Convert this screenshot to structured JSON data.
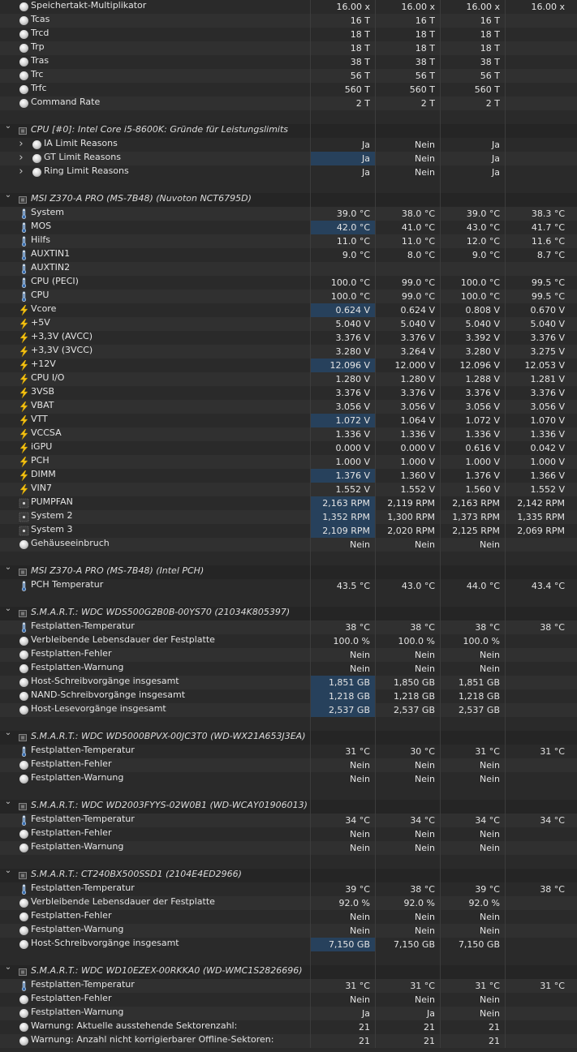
{
  "colors": {
    "background": "#2b2b2b",
    "highlight": "#27415c",
    "text": "#e4e4e4"
  },
  "rows": [
    {
      "t": "s",
      "icon": "circle",
      "label": "Speichertakt-Multiplikator",
      "v": [
        "16.00 x",
        "16.00 x",
        "16.00 x",
        "16.00 x"
      ]
    },
    {
      "t": "s",
      "icon": "circle",
      "label": "Tcas",
      "v": [
        "16 T",
        "16 T",
        "16 T",
        ""
      ]
    },
    {
      "t": "s",
      "icon": "circle",
      "label": "Trcd",
      "v": [
        "18 T",
        "18 T",
        "18 T",
        ""
      ]
    },
    {
      "t": "s",
      "icon": "circle",
      "label": "Trp",
      "v": [
        "18 T",
        "18 T",
        "18 T",
        ""
      ]
    },
    {
      "t": "s",
      "icon": "circle",
      "label": "Tras",
      "v": [
        "38 T",
        "38 T",
        "38 T",
        ""
      ]
    },
    {
      "t": "s",
      "icon": "circle",
      "label": "Trc",
      "v": [
        "56 T",
        "56 T",
        "56 T",
        ""
      ]
    },
    {
      "t": "s",
      "icon": "circle",
      "label": "Trfc",
      "v": [
        "560 T",
        "560 T",
        "560 T",
        ""
      ]
    },
    {
      "t": "s",
      "icon": "circle",
      "label": "Command Rate",
      "v": [
        "2 T",
        "2 T",
        "2 T",
        ""
      ]
    },
    {
      "t": "b"
    },
    {
      "t": "g",
      "label": "CPU [#0]: Intel Core i5-8600K: Gründe für Leistungslimits"
    },
    {
      "t": "s",
      "icon": "circle",
      "sub": true,
      "label": "IA Limit Reasons",
      "v": [
        "Ja",
        "Nein",
        "Ja",
        ""
      ]
    },
    {
      "t": "s",
      "icon": "circle",
      "sub": true,
      "label": "GT Limit Reasons",
      "v": [
        "Ja",
        "Nein",
        "Ja",
        ""
      ],
      "hl": true
    },
    {
      "t": "s",
      "icon": "circle",
      "sub": true,
      "label": "Ring Limit Reasons",
      "v": [
        "Ja",
        "Nein",
        "Ja",
        ""
      ]
    },
    {
      "t": "b"
    },
    {
      "t": "g",
      "label": "MSI Z370-A PRO (MS-7B48) (Nuvoton NCT6795D)"
    },
    {
      "t": "s",
      "icon": "therm",
      "label": "System",
      "v": [
        "39.0 °C",
        "38.0 °C",
        "39.0 °C",
        "38.3 °C"
      ]
    },
    {
      "t": "s",
      "icon": "therm",
      "label": "MOS",
      "v": [
        "42.0 °C",
        "41.0 °C",
        "43.0 °C",
        "41.7 °C"
      ],
      "hl": true
    },
    {
      "t": "s",
      "icon": "therm",
      "label": "Hilfs",
      "v": [
        "11.0 °C",
        "11.0 °C",
        "12.0 °C",
        "11.6 °C"
      ]
    },
    {
      "t": "s",
      "icon": "therm",
      "label": "AUXTIN1",
      "v": [
        "9.0 °C",
        "8.0 °C",
        "9.0 °C",
        "8.7 °C"
      ]
    },
    {
      "t": "s",
      "icon": "therm",
      "label": "AUXTIN2",
      "v": [
        "",
        "",
        "",
        ""
      ]
    },
    {
      "t": "s",
      "icon": "therm",
      "label": "CPU (PECI)",
      "v": [
        "100.0 °C",
        "99.0 °C",
        "100.0 °C",
        "99.5 °C"
      ]
    },
    {
      "t": "s",
      "icon": "therm",
      "label": "CPU",
      "v": [
        "100.0 °C",
        "99.0 °C",
        "100.0 °C",
        "99.5 °C"
      ]
    },
    {
      "t": "s",
      "icon": "bolt",
      "label": "Vcore",
      "v": [
        "0.624 V",
        "0.624 V",
        "0.808 V",
        "0.670 V"
      ],
      "hl": true
    },
    {
      "t": "s",
      "icon": "bolt",
      "label": "+5V",
      "v": [
        "5.040 V",
        "5.040 V",
        "5.040 V",
        "5.040 V"
      ]
    },
    {
      "t": "s",
      "icon": "bolt",
      "label": "+3,3V (AVCC)",
      "v": [
        "3.376 V",
        "3.376 V",
        "3.392 V",
        "3.376 V"
      ]
    },
    {
      "t": "s",
      "icon": "bolt",
      "label": "+3,3V (3VCC)",
      "v": [
        "3.280 V",
        "3.264 V",
        "3.280 V",
        "3.275 V"
      ]
    },
    {
      "t": "s",
      "icon": "bolt",
      "label": "+12V",
      "v": [
        "12.096 V",
        "12.000 V",
        "12.096 V",
        "12.053 V"
      ],
      "hl": true
    },
    {
      "t": "s",
      "icon": "bolt",
      "label": "CPU I/O",
      "v": [
        "1.280 V",
        "1.280 V",
        "1.288 V",
        "1.281 V"
      ]
    },
    {
      "t": "s",
      "icon": "bolt",
      "label": "3VSB",
      "v": [
        "3.376 V",
        "3.376 V",
        "3.376 V",
        "3.376 V"
      ]
    },
    {
      "t": "s",
      "icon": "bolt",
      "label": "VBAT",
      "v": [
        "3.056 V",
        "3.056 V",
        "3.056 V",
        "3.056 V"
      ]
    },
    {
      "t": "s",
      "icon": "bolt",
      "label": "VTT",
      "v": [
        "1.072 V",
        "1.064 V",
        "1.072 V",
        "1.070 V"
      ],
      "hl": true
    },
    {
      "t": "s",
      "icon": "bolt",
      "label": "VCCSA",
      "v": [
        "1.336 V",
        "1.336 V",
        "1.336 V",
        "1.336 V"
      ]
    },
    {
      "t": "s",
      "icon": "bolt",
      "label": "iGPU",
      "v": [
        "0.000 V",
        "0.000 V",
        "0.616 V",
        "0.042 V"
      ]
    },
    {
      "t": "s",
      "icon": "bolt",
      "label": "PCH",
      "v": [
        "1.000 V",
        "1.000 V",
        "1.000 V",
        "1.000 V"
      ]
    },
    {
      "t": "s",
      "icon": "bolt",
      "label": "DIMM",
      "v": [
        "1.376 V",
        "1.360 V",
        "1.376 V",
        "1.366 V"
      ],
      "hl": true
    },
    {
      "t": "s",
      "icon": "bolt",
      "label": "VIN7",
      "v": [
        "1.552 V",
        "1.552 V",
        "1.560 V",
        "1.552 V"
      ]
    },
    {
      "t": "s",
      "icon": "fan",
      "label": "PUMPFAN",
      "v": [
        "2,163 RPM",
        "2,119 RPM",
        "2,163 RPM",
        "2,142 RPM"
      ],
      "hl": true
    },
    {
      "t": "s",
      "icon": "fan",
      "label": "System 2",
      "v": [
        "1,352 RPM",
        "1,300 RPM",
        "1,373 RPM",
        "1,335 RPM"
      ],
      "hl": true
    },
    {
      "t": "s",
      "icon": "fan",
      "label": "System 3",
      "v": [
        "2,109 RPM",
        "2,020 RPM",
        "2,125 RPM",
        "2,069 RPM"
      ],
      "hl": true
    },
    {
      "t": "s",
      "icon": "circle",
      "label": "Gehäuseeinbruch",
      "v": [
        "Nein",
        "Nein",
        "Nein",
        ""
      ]
    },
    {
      "t": "b"
    },
    {
      "t": "g",
      "label": "MSI Z370-A PRO (MS-7B48) (Intel PCH)"
    },
    {
      "t": "s",
      "icon": "therm",
      "label": "PCH Temperatur",
      "v": [
        "43.5 °C",
        "43.0 °C",
        "44.0 °C",
        "43.4 °C"
      ]
    },
    {
      "t": "b"
    },
    {
      "t": "g",
      "label": "S.M.A.R.T.: WDC  WDS500G2B0B-00YS70 (21034K805397)"
    },
    {
      "t": "s",
      "icon": "therm",
      "label": "Festplatten-Temperatur",
      "v": [
        "38 °C",
        "38 °C",
        "38 °C",
        "38 °C"
      ]
    },
    {
      "t": "s",
      "icon": "circle",
      "label": "Verbleibende Lebensdauer der Festplatte",
      "v": [
        "100.0 %",
        "100.0 %",
        "100.0 %",
        ""
      ]
    },
    {
      "t": "s",
      "icon": "circle",
      "label": "Festplatten-Fehler",
      "v": [
        "Nein",
        "Nein",
        "Nein",
        ""
      ]
    },
    {
      "t": "s",
      "icon": "circle",
      "label": "Festplatten-Warnung",
      "v": [
        "Nein",
        "Nein",
        "Nein",
        ""
      ]
    },
    {
      "t": "s",
      "icon": "circle",
      "label": "Host-Schreibvorgänge insgesamt",
      "v": [
        "1,851 GB",
        "1,850 GB",
        "1,851 GB",
        ""
      ],
      "hl": true
    },
    {
      "t": "s",
      "icon": "circle",
      "label": "NAND-Schreibvorgänge insgesamt",
      "v": [
        "1,218 GB",
        "1,218 GB",
        "1,218 GB",
        ""
      ],
      "hl": true
    },
    {
      "t": "s",
      "icon": "circle",
      "label": "Host-Lesevorgänge insgesamt",
      "v": [
        "2,537 GB",
        "2,537 GB",
        "2,537 GB",
        ""
      ],
      "hl": true
    },
    {
      "t": "b"
    },
    {
      "t": "g",
      "label": "S.M.A.R.T.: WDC WD5000BPVX-00JC3T0 (WD-WX21A653J3EA)"
    },
    {
      "t": "s",
      "icon": "therm",
      "label": "Festplatten-Temperatur",
      "v": [
        "31 °C",
        "30 °C",
        "31 °C",
        "31 °C"
      ]
    },
    {
      "t": "s",
      "icon": "circle",
      "label": "Festplatten-Fehler",
      "v": [
        "Nein",
        "Nein",
        "Nein",
        ""
      ]
    },
    {
      "t": "s",
      "icon": "circle",
      "label": "Festplatten-Warnung",
      "v": [
        "Nein",
        "Nein",
        "Nein",
        ""
      ]
    },
    {
      "t": "b"
    },
    {
      "t": "g",
      "label": "S.M.A.R.T.: WDC WD2003FYYS-02W0B1 (WD-WCAY01906013)"
    },
    {
      "t": "s",
      "icon": "therm",
      "label": "Festplatten-Temperatur",
      "v": [
        "34 °C",
        "34 °C",
        "34 °C",
        "34 °C"
      ]
    },
    {
      "t": "s",
      "icon": "circle",
      "label": "Festplatten-Fehler",
      "v": [
        "Nein",
        "Nein",
        "Nein",
        ""
      ]
    },
    {
      "t": "s",
      "icon": "circle",
      "label": "Festplatten-Warnung",
      "v": [
        "Nein",
        "Nein",
        "Nein",
        ""
      ]
    },
    {
      "t": "b"
    },
    {
      "t": "g",
      "label": "S.M.A.R.T.: CT240BX500SSD1 (2104E4ED2966)"
    },
    {
      "t": "s",
      "icon": "therm",
      "label": "Festplatten-Temperatur",
      "v": [
        "39 °C",
        "38 °C",
        "39 °C",
        "38 °C"
      ]
    },
    {
      "t": "s",
      "icon": "circle",
      "label": "Verbleibende Lebensdauer der Festplatte",
      "v": [
        "92.0 %",
        "92.0 %",
        "92.0 %",
        ""
      ]
    },
    {
      "t": "s",
      "icon": "circle",
      "label": "Festplatten-Fehler",
      "v": [
        "Nein",
        "Nein",
        "Nein",
        ""
      ]
    },
    {
      "t": "s",
      "icon": "circle",
      "label": "Festplatten-Warnung",
      "v": [
        "Nein",
        "Nein",
        "Nein",
        ""
      ]
    },
    {
      "t": "s",
      "icon": "circle",
      "label": "Host-Schreibvorgänge insgesamt",
      "v": [
        "7,150 GB",
        "7,150 GB",
        "7,150 GB",
        ""
      ],
      "hl": true
    },
    {
      "t": "b"
    },
    {
      "t": "g",
      "label": "S.M.A.R.T.: WDC WD10EZEX-00RKKA0 (WD-WMC1S2826696)"
    },
    {
      "t": "s",
      "icon": "therm",
      "label": "Festplatten-Temperatur",
      "v": [
        "31 °C",
        "31 °C",
        "31 °C",
        "31 °C"
      ]
    },
    {
      "t": "s",
      "icon": "circle",
      "label": "Festplatten-Fehler",
      "v": [
        "Nein",
        "Nein",
        "Nein",
        ""
      ]
    },
    {
      "t": "s",
      "icon": "circle",
      "label": "Festplatten-Warnung",
      "v": [
        "Ja",
        "Ja",
        "Nein",
        ""
      ]
    },
    {
      "t": "s",
      "icon": "circle",
      "label": "Warnung: Aktuelle ausstehende Sektorenzahl:",
      "v": [
        "21",
        "21",
        "21",
        ""
      ]
    },
    {
      "t": "s",
      "icon": "circle",
      "label": "Warnung: Anzahl nicht korrigierbarer Offline-Sektoren:",
      "v": [
        "21",
        "21",
        "21",
        ""
      ]
    }
  ]
}
